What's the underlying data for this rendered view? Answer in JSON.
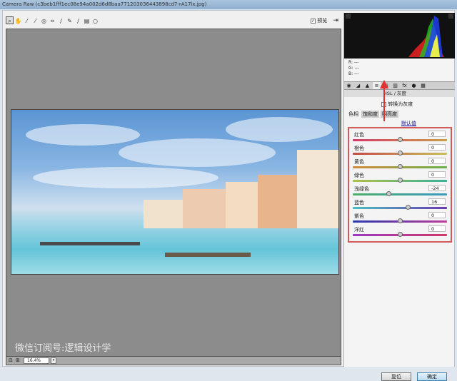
{
  "window": {
    "title": "Camera Raw (c3beb1fff1ec08e94a002d6d8baa771203036443898cd7-rA17lx.jpg)"
  },
  "toolbar": {
    "tools": [
      "zoom-tool",
      "hand-tool",
      "white-balance-tool",
      "color-sampler-tool",
      "target-adjust-tool",
      "crop-tool",
      "straighten-tool",
      "spot-removal-tool",
      "red-eye-tool",
      "preferences-tool",
      "rotate-tool"
    ],
    "preview_label": "预览",
    "preview_checked": true
  },
  "canvas": {
    "watermark": "微信订阅号:逻辑设计学",
    "zoom": "16.4%"
  },
  "panel": {
    "readout": {
      "r": "R: ---",
      "g": "G: ---",
      "b": "B: ---"
    },
    "section_title": "HSL / 灰度",
    "grayscale_label": "转换为灰度",
    "tabs": [
      {
        "label": "色相",
        "active": true
      },
      {
        "label": "饱和度",
        "active": false
      },
      {
        "label": "明亮度",
        "active": false
      }
    ],
    "defaults_link": "默认值",
    "sliders": [
      {
        "label": "红色",
        "value": "0",
        "num": 0,
        "colors": [
          "#d43a6a",
          "#c9a04a"
        ]
      },
      {
        "label": "橙色",
        "value": "0",
        "num": 0,
        "colors": [
          "#c44a4a",
          "#c9c05a"
        ]
      },
      {
        "label": "黄色",
        "value": "0",
        "num": 0,
        "colors": [
          "#d08a3a",
          "#6ab04a"
        ]
      },
      {
        "label": "绿色",
        "value": "0",
        "num": 0,
        "colors": [
          "#b0c04a",
          "#3ab09a"
        ]
      },
      {
        "label": "浅绿色",
        "value": "-24",
        "num": -24,
        "colors": [
          "#4ab06a",
          "#3a9ac0"
        ]
      },
      {
        "label": "蓝色",
        "value": "16",
        "num": 16,
        "colors": [
          "#4ac0c0",
          "#6a3ab0"
        ]
      },
      {
        "label": "紫色",
        "value": "0",
        "num": 0,
        "colors": [
          "#2a3ab0",
          "#c03a9a"
        ]
      },
      {
        "label": "洋红",
        "value": "0",
        "num": 0,
        "colors": [
          "#9a3ac0",
          "#d03a6a"
        ]
      }
    ]
  },
  "buttons": {
    "reset": "复位",
    "ok": "确定"
  },
  "colors": {
    "highlight_box": "#d35a5a",
    "arrow": "#e03030"
  }
}
